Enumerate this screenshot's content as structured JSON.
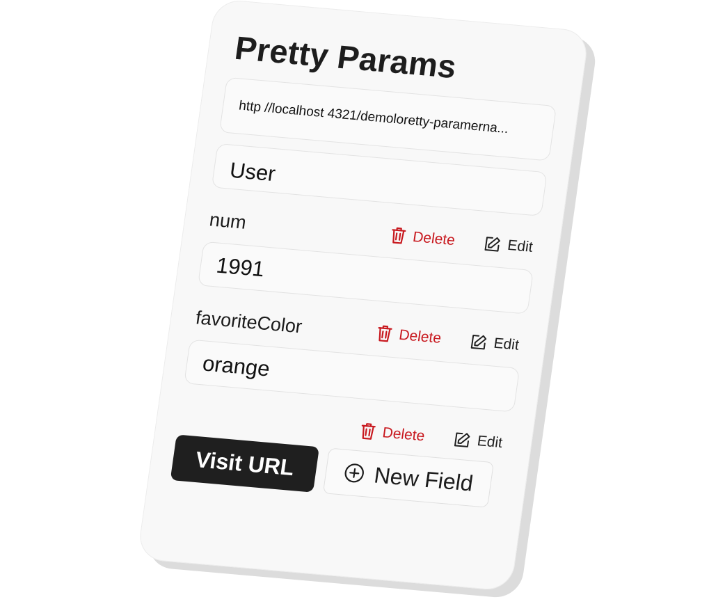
{
  "app": {
    "title": "Pretty Params"
  },
  "url_field": {
    "value": "http //localhost 4321/demoloretty-paramerna..."
  },
  "name_field": {
    "value": "User"
  },
  "params": [
    {
      "label": "num",
      "value": "1991"
    },
    {
      "label": "favoriteColor",
      "value": "orange"
    }
  ],
  "actions": {
    "delete_label": "Delete",
    "edit_label": "Edit"
  },
  "buttons": {
    "visit_label": "Visit URL",
    "new_field_label": "New Field"
  },
  "icons": {
    "delete": "trash-icon",
    "edit": "pencil-square-icon",
    "add": "plus-circle-icon"
  },
  "colors": {
    "delete": "#c8191f",
    "primary_button": "#1f1f1f",
    "card_background": "#f8f8f8"
  }
}
